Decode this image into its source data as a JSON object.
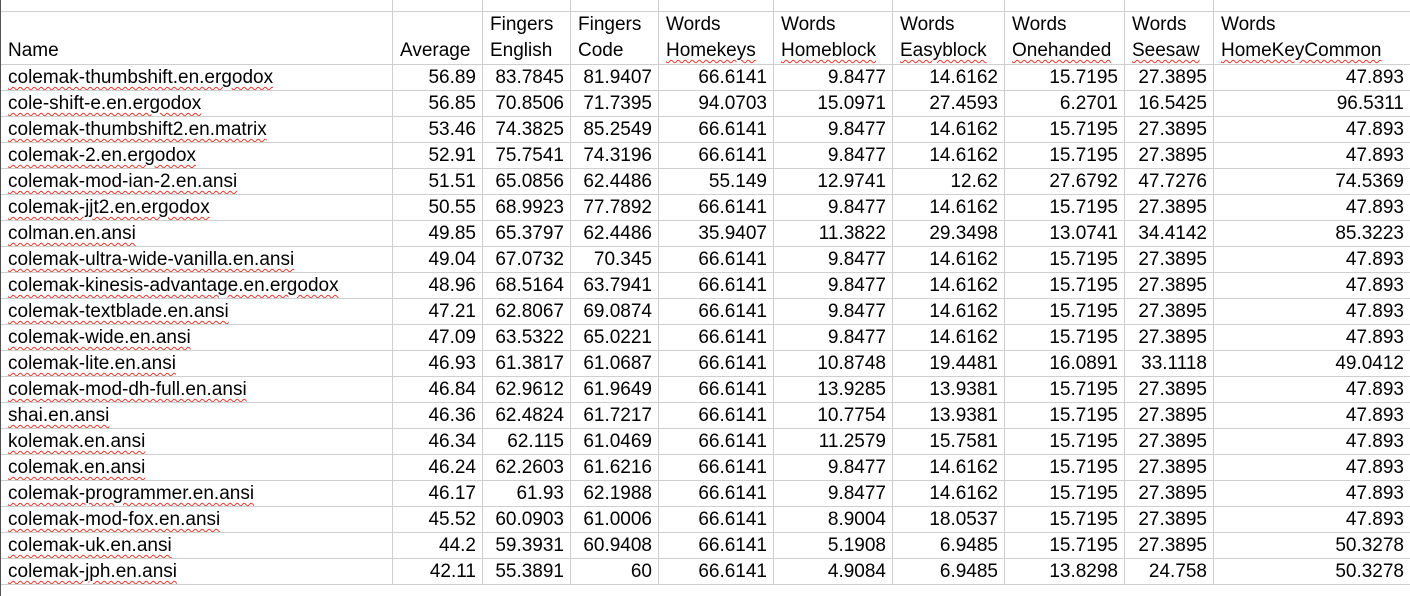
{
  "sheet": {
    "columns": [
      {
        "top": "",
        "bottom": "Name"
      },
      {
        "top": "",
        "bottom": "Average"
      },
      {
        "top": "Fingers",
        "bottom": "English"
      },
      {
        "top": "Fingers",
        "bottom": "Code"
      },
      {
        "top": "Words",
        "bottom": "Homekeys"
      },
      {
        "top": "Words",
        "bottom": "Homeblock"
      },
      {
        "top": "Words",
        "bottom": "Easyblock"
      },
      {
        "top": "Words",
        "bottom": "Onehanded"
      },
      {
        "top": "Words",
        "bottom": "Seesaw"
      },
      {
        "top": "Words",
        "bottom": "HomeKeyCommon"
      }
    ],
    "rows": [
      {
        "name": "colemak-thumbshift.en.ergodox",
        "values": [
          "56.89",
          "83.7845",
          "81.9407",
          "66.6141",
          "9.8477",
          "14.6162",
          "15.7195",
          "27.3895",
          "47.893"
        ]
      },
      {
        "name": "cole-shift-e.en.ergodox",
        "values": [
          "56.85",
          "70.8506",
          "71.7395",
          "94.0703",
          "15.0971",
          "27.4593",
          "6.2701",
          "16.5425",
          "96.5311"
        ]
      },
      {
        "name": "colemak-thumbshift2.en.matrix",
        "values": [
          "53.46",
          "74.3825",
          "85.2549",
          "66.6141",
          "9.8477",
          "14.6162",
          "15.7195",
          "27.3895",
          "47.893"
        ]
      },
      {
        "name": "colemak-2.en.ergodox",
        "values": [
          "52.91",
          "75.7541",
          "74.3196",
          "66.6141",
          "9.8477",
          "14.6162",
          "15.7195",
          "27.3895",
          "47.893"
        ]
      },
      {
        "name": "colemak-mod-ian-2.en.ansi",
        "values": [
          "51.51",
          "65.0856",
          "62.4486",
          "55.149",
          "12.9741",
          "12.62",
          "27.6792",
          "47.7276",
          "74.5369"
        ]
      },
      {
        "name": "colemak-jjt2.en.ergodox",
        "values": [
          "50.55",
          "68.9923",
          "77.7892",
          "66.6141",
          "9.8477",
          "14.6162",
          "15.7195",
          "27.3895",
          "47.893"
        ]
      },
      {
        "name": "colman.en.ansi",
        "values": [
          "49.85",
          "65.3797",
          "62.4486",
          "35.9407",
          "11.3822",
          "29.3498",
          "13.0741",
          "34.4142",
          "85.3223"
        ]
      },
      {
        "name": "colemak-ultra-wide-vanilla.en.ansi",
        "values": [
          "49.04",
          "67.0732",
          "70.345",
          "66.6141",
          "9.8477",
          "14.6162",
          "15.7195",
          "27.3895",
          "47.893"
        ]
      },
      {
        "name": "colemak-kinesis-advantage.en.ergodox",
        "values": [
          "48.96",
          "68.5164",
          "63.7941",
          "66.6141",
          "9.8477",
          "14.6162",
          "15.7195",
          "27.3895",
          "47.893"
        ]
      },
      {
        "name": "colemak-textblade.en.ansi",
        "values": [
          "47.21",
          "62.8067",
          "69.0874",
          "66.6141",
          "9.8477",
          "14.6162",
          "15.7195",
          "27.3895",
          "47.893"
        ]
      },
      {
        "name": "colemak-wide.en.ansi",
        "values": [
          "47.09",
          "63.5322",
          "65.0221",
          "66.6141",
          "9.8477",
          "14.6162",
          "15.7195",
          "27.3895",
          "47.893"
        ]
      },
      {
        "name": "colemak-lite.en.ansi",
        "values": [
          "46.93",
          "61.3817",
          "61.0687",
          "66.6141",
          "10.8748",
          "19.4481",
          "16.0891",
          "33.1118",
          "49.0412"
        ]
      },
      {
        "name": "colemak-mod-dh-full.en.ansi",
        "values": [
          "46.84",
          "62.9612",
          "61.9649",
          "66.6141",
          "13.9285",
          "13.9381",
          "15.7195",
          "27.3895",
          "47.893"
        ]
      },
      {
        "name": "shai.en.ansi",
        "values": [
          "46.36",
          "62.4824",
          "61.7217",
          "66.6141",
          "10.7754",
          "13.9381",
          "15.7195",
          "27.3895",
          "47.893"
        ]
      },
      {
        "name": "kolemak.en.ansi",
        "values": [
          "46.34",
          "62.115",
          "61.0469",
          "66.6141",
          "11.2579",
          "15.7581",
          "15.7195",
          "27.3895",
          "47.893"
        ]
      },
      {
        "name": "colemak.en.ansi",
        "values": [
          "46.24",
          "62.2603",
          "61.6216",
          "66.6141",
          "9.8477",
          "14.6162",
          "15.7195",
          "27.3895",
          "47.893"
        ]
      },
      {
        "name": "colemak-programmer.en.ansi",
        "values": [
          "46.17",
          "61.93",
          "62.1988",
          "66.6141",
          "9.8477",
          "14.6162",
          "15.7195",
          "27.3895",
          "47.893"
        ]
      },
      {
        "name": "colemak-mod-fox.en.ansi",
        "values": [
          "45.52",
          "60.0903",
          "61.0006",
          "66.6141",
          "8.9004",
          "18.0537",
          "15.7195",
          "27.3895",
          "47.893"
        ]
      },
      {
        "name": "colemak-uk.en.ansi",
        "values": [
          "44.2",
          "59.3931",
          "60.9408",
          "66.6141",
          "5.1908",
          "6.9485",
          "15.7195",
          "27.3895",
          "50.3278"
        ]
      },
      {
        "name": "colemak-jph.en.ansi",
        "values": [
          "42.11",
          "55.3891",
          "60",
          "66.6141",
          "4.9084",
          "6.9485",
          "13.8298",
          "24.758",
          "50.3278"
        ]
      }
    ]
  }
}
